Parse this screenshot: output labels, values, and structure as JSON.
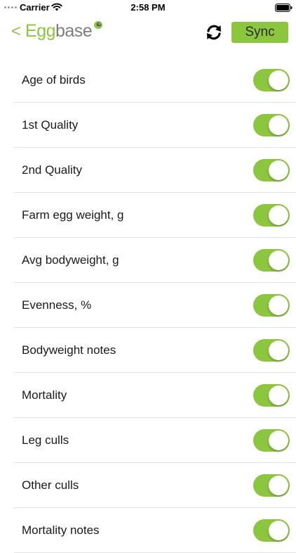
{
  "colors": {
    "accent": "#8cc63f",
    "divider": "#e3e3e3"
  },
  "status_bar": {
    "carrier": "Carrier",
    "time": "2:58 PM"
  },
  "nav": {
    "back_icon": "chevron-left-icon",
    "logo_egg": "Egg",
    "logo_base": "base",
    "refresh_icon": "refresh-icon",
    "sync_label": "Sync"
  },
  "settings": [
    {
      "label": "Age of birds",
      "enabled": true
    },
    {
      "label": "1st Quality",
      "enabled": true
    },
    {
      "label": "2nd Quality",
      "enabled": true
    },
    {
      "label": "Farm egg weight, g",
      "enabled": true
    },
    {
      "label": "Avg bodyweight, g",
      "enabled": true
    },
    {
      "label": "Evenness, %",
      "enabled": true
    },
    {
      "label": "Bodyweight notes",
      "enabled": true
    },
    {
      "label": "Mortality",
      "enabled": true
    },
    {
      "label": "Leg culls",
      "enabled": true
    },
    {
      "label": "Other culls",
      "enabled": true
    },
    {
      "label": "Mortality notes",
      "enabled": true
    }
  ]
}
